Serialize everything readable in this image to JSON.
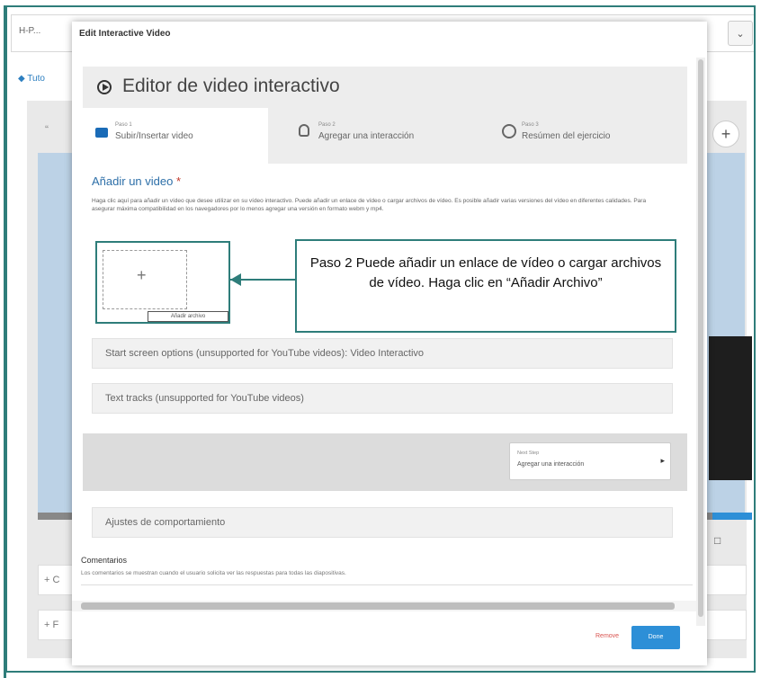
{
  "background": {
    "title": "H-P...",
    "link": "◆ Tuto",
    "rows": [
      "+ C",
      "+ F"
    ]
  },
  "dialog": {
    "title": "Edit Interactive Video",
    "editor_title": "Editor de video interactivo",
    "tabs": [
      {
        "step": "Paso 1",
        "label": "Subir/Insertar video",
        "icon": "video-camera-icon"
      },
      {
        "step": "Paso 2",
        "label": "Agregar una interacción",
        "icon": "lightbulb-icon"
      },
      {
        "step": "Paso 3",
        "label": "Resúmen del ejercicio",
        "icon": "check-circle-icon"
      }
    ],
    "section_title": "Añadir un video",
    "required_mark": "*",
    "description": "Haga clic aquí para añadir un vídeo que desee utilizar en su vídeo interactivo. Puede añadir un enlace de vídeo o cargar archivos de vídeo. Es posible añadir varias versiones del vídeo en diferentes calidades. Para asegurar máxima compatibilidad en los navegadores por lo menos agregar una versión en formato webm y mp4.",
    "add_file_button": "Añadir archivo",
    "accordions": [
      "Start screen options (unsupported for YouTube videos): Video Interactivo",
      "Text tracks (unsupported for YouTube videos)"
    ],
    "next_step": {
      "step": "Next Step",
      "label": "Agregar una interacción"
    },
    "behaviour": "Ajustes de comportamiento",
    "comments_title": "Comentarios",
    "comments_desc": "Los comentarios se muestran cuando el usuario solicita ver las respuestas para todas las diapositivas.",
    "remove_label": "Remove",
    "done_label": "Done"
  },
  "callout": {
    "text": "Paso 2 Puede añadir un enlace de vídeo o cargar archivos de vídeo. Haga clic en “Añadir Archivo”"
  },
  "colors": {
    "frame": "#2e7d7a",
    "accent_blue": "#2d8fd7",
    "link_blue": "#2d6fa8"
  }
}
